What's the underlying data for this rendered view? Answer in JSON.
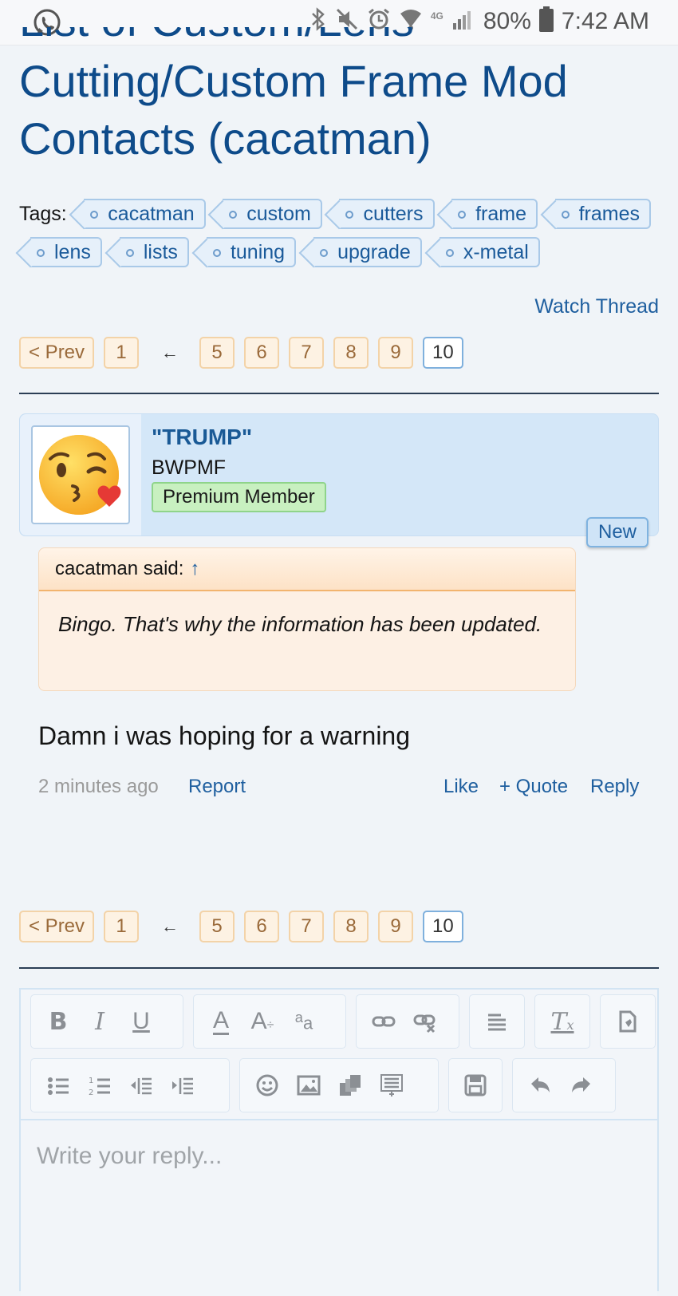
{
  "status_bar": {
    "battery": "80%",
    "time": "7:42 AM",
    "network": "4G",
    "icons": [
      "whatsapp-icon",
      "bluetooth-icon",
      "mute-icon",
      "alarm-icon",
      "wifi-icon",
      "signal-icon",
      "battery-icon"
    ]
  },
  "thread": {
    "title_cut": "List of Custom/Lens",
    "title_line1": "Cutting/Custom Frame Mod",
    "title_line2": "Contacts (cacatman)"
  },
  "tags": {
    "label": "Tags:",
    "row1": [
      "cacatman",
      "custom",
      "cutters",
      "frame",
      "frames"
    ],
    "row2": [
      "lens",
      "lists",
      "tuning",
      "upgrade",
      "x-metal"
    ]
  },
  "watch_thread": "Watch Thread",
  "pagination": {
    "prev": "< Prev",
    "first": "1",
    "skip": "←",
    "pages": [
      "5",
      "6",
      "7",
      "8",
      "9"
    ],
    "current": "10"
  },
  "post": {
    "username": "\"TRUMP\"",
    "user_title": "BWPMF",
    "badge": "Premium Member",
    "new_label": "New",
    "quote_author": "cacatman said:",
    "quote_arrow": "↑",
    "quote_text": "Bingo. That's why the information has been updated.",
    "message": "Damn i was hoping for a warning",
    "time": "2 minutes ago",
    "report": "Report",
    "like": "Like",
    "quote": "+ Quote",
    "reply": "Reply"
  },
  "editor": {
    "placeholder": "Write your reply...",
    "toolbar": [
      "bold",
      "italic",
      "underline",
      "font-color",
      "font-size",
      "font-family",
      "link",
      "unlink",
      "align",
      "remove-format",
      "insert-code",
      "bullet-list",
      "number-list",
      "outdent",
      "indent",
      "smilies",
      "image",
      "media",
      "quote-block",
      "save-draft",
      "undo",
      "redo"
    ]
  },
  "colors": {
    "title": "#0e4b8a",
    "link": "#1f5f9f",
    "post_bg": "#d4e7f8",
    "page_bg": "#f0f4f8"
  }
}
